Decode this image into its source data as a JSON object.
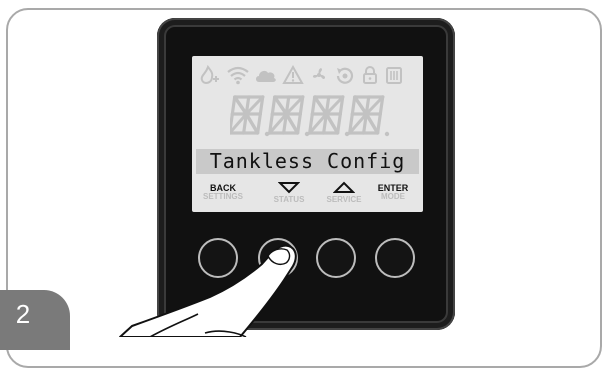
{
  "step": {
    "number": "2"
  },
  "display": {
    "text": "Tankless Config",
    "segment_placeholder": "8.8.8.8.",
    "icons": [
      "flame-icon",
      "wifi-icon",
      "cloud-icon",
      "warning-icon",
      "fan-icon",
      "recirculation-icon",
      "lock-icon",
      "heater-icon"
    ],
    "buttons": [
      {
        "label": "BACK",
        "sub": "SETTINGS"
      },
      {
        "label": "",
        "sub": "STATUS",
        "icon": "down-arrow-icon"
      },
      {
        "label": "",
        "sub": "SERVICE",
        "icon": "up-arrow-icon"
      },
      {
        "label": "ENTER",
        "sub": "MODE"
      }
    ],
    "pressed_button": "STATUS"
  },
  "colors": {
    "bezel": "#111111",
    "lcd_background": "#e6e6e6",
    "text_band": "#c9c9c9",
    "inactive_segment": "#c2c2c2",
    "step_tab": "#7a7a7a"
  }
}
